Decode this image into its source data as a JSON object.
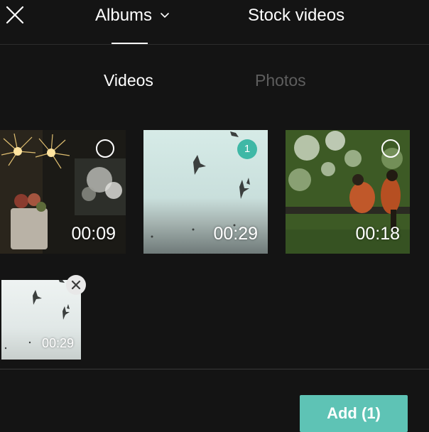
{
  "header": {
    "close_icon": "close-icon",
    "albums_label": "Albums",
    "albums_chevron_icon": "chevron-down-icon",
    "stock_label": "Stock videos"
  },
  "media_tabs": {
    "videos_label": "Videos",
    "photos_label": "Photos"
  },
  "grid": {
    "items": [
      {
        "duration": "00:09",
        "selected": false,
        "thumbnail": "sparklers-and-flowers"
      },
      {
        "duration": "00:29",
        "selected": true,
        "selection_number": "1",
        "thumbnail": "seagulls-flying"
      },
      {
        "duration": "00:18",
        "selected": false,
        "thumbnail": "birds-on-branch"
      }
    ]
  },
  "selected_strip": {
    "items": [
      {
        "duration": "00:29",
        "thumbnail": "seagulls-flying",
        "remove_icon": "close-icon"
      }
    ]
  },
  "footer": {
    "add_label": "Add (1)"
  },
  "colors": {
    "background": "#141414",
    "accent": "#5ec3b5",
    "selection_badge": "#3fb8a6",
    "inactive_tab": "#5e5e5e"
  }
}
